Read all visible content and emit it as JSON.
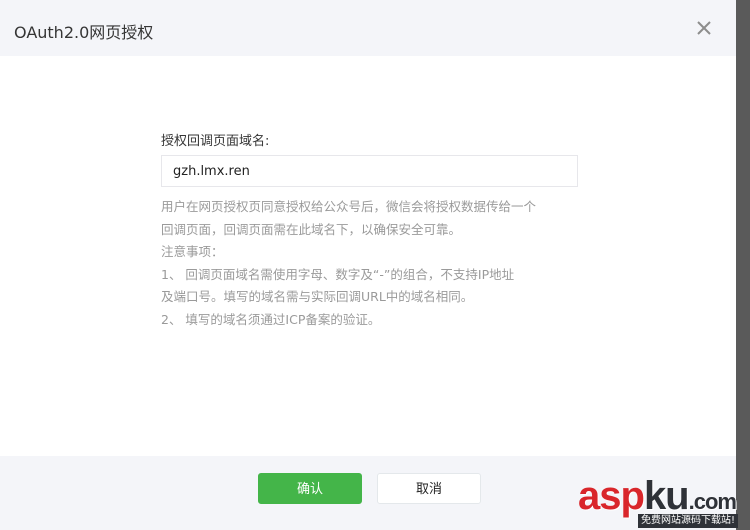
{
  "dialog": {
    "title": "OAuth2.0网页授权",
    "close_icon": "close-icon"
  },
  "form": {
    "label": "授权回调页面域名:",
    "domain_value": "gzh.lmx.ren"
  },
  "help": {
    "line1": "用户在网页授权页同意授权给公众号后，微信会将授权数据传给一个",
    "line2": "回调页面，回调页面需在此域名下，以确保安全可靠。",
    "line3": "注意事项：",
    "line4": "1、 回调页面域名需使用字母、数字及“-”的组合，不支持IP地址",
    "line5": "及端口号。填写的域名需与实际回调URL中的域名相同。",
    "line6": "2、 填写的域名须通过ICP备案的验证。"
  },
  "footer": {
    "confirm_label": "确认",
    "cancel_label": "取消"
  },
  "watermark": {
    "brand_red": "asp",
    "brand_dark": "ku",
    "brand_tail": ".com",
    "tagline": "免费网站源码下载站!"
  },
  "colors": {
    "primary": "#44b549",
    "header_bg": "#f4f5f9",
    "help_text": "#9a9a9a"
  }
}
